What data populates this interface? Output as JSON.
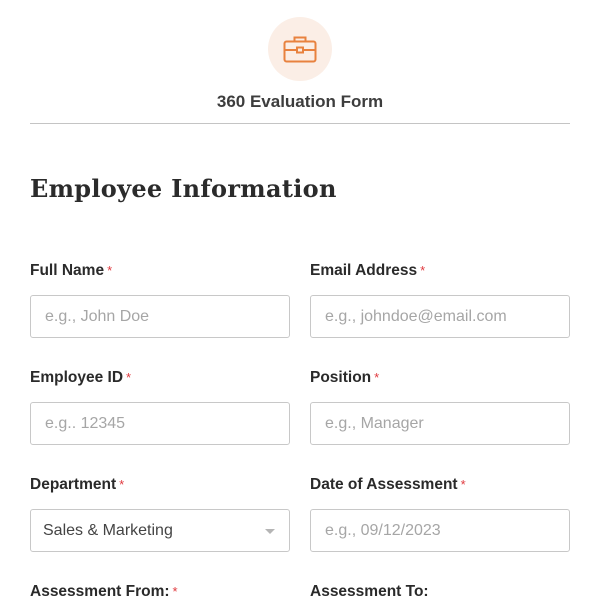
{
  "header": {
    "icon": "briefcase-icon",
    "accent_color": "#e8823f",
    "icon_bg_color": "#fbeee6",
    "title": "360 Evaluation Form"
  },
  "section": {
    "title": "Employee Information"
  },
  "required_marker": "*",
  "fields": {
    "full_name": {
      "label": "Full Name",
      "required": true,
      "placeholder": "e.g., John Doe"
    },
    "email": {
      "label": "Email Address",
      "required": true,
      "placeholder": "e.g., johndoe@email.com"
    },
    "employee_id": {
      "label": "Employee ID",
      "required": true,
      "placeholder": "e.g.. 12345"
    },
    "position": {
      "label": "Position",
      "required": true,
      "placeholder": "e.g., Manager"
    },
    "department": {
      "label": "Department",
      "required": true,
      "value": "Sales & Marketing"
    },
    "date_of_assessment": {
      "label": "Date of Assessment",
      "required": true,
      "placeholder": "e.g., 09/12/2023"
    },
    "assessment_from": {
      "label": "Assessment From:",
      "required": true
    },
    "assessment_to": {
      "label": "Assessment To:",
      "required": false
    }
  }
}
